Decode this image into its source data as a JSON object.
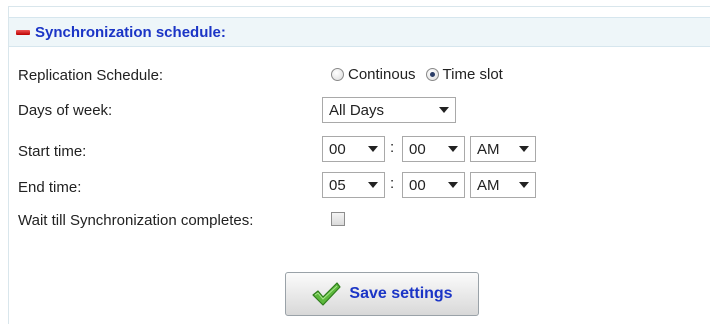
{
  "section": {
    "title": "Synchronization schedule:"
  },
  "replication": {
    "label": "Replication Schedule:",
    "options": [
      {
        "label": "Continous",
        "checked": false
      },
      {
        "label": "Time slot",
        "checked": true
      }
    ]
  },
  "days": {
    "label": "Days of week:",
    "value": "All Days"
  },
  "start": {
    "label": "Start time:",
    "hour": "00",
    "minute": "00",
    "ampm": "AM",
    "separator": ":"
  },
  "end": {
    "label": "End time:",
    "hour": "05",
    "minute": "00",
    "ampm": "AM",
    "separator": ":"
  },
  "wait": {
    "label": "Wait till Synchronization completes:",
    "checked": false
  },
  "save": {
    "label": "Save settings"
  },
  "icons": {
    "section_toggle": "collapse-icon",
    "save": "checkmark-icon"
  },
  "colors": {
    "accent": "#1b35c6",
    "header_bg": "#eef6f9",
    "toggle": "#cc0000"
  }
}
